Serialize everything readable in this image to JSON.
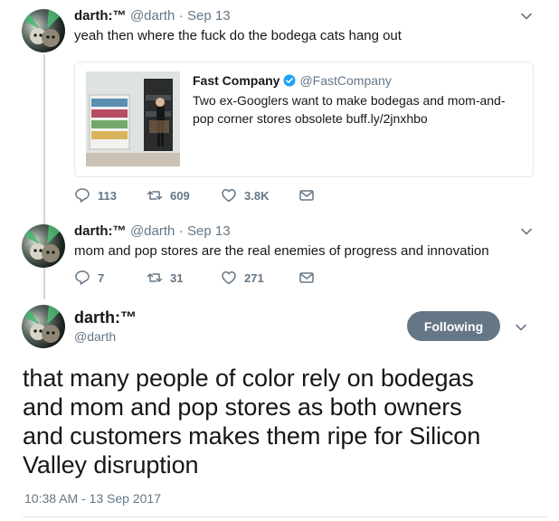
{
  "colors": {
    "text": "#14171a",
    "secondary": "#657786",
    "verified": "#1da1f2",
    "border": "#e1e8ed",
    "following_button": "#657786"
  },
  "tweet1": {
    "name": "darth:™",
    "handle": "@darth",
    "date": "· Sep 13",
    "text": "yeah then where the fuck do the bodega cats hang out",
    "card": {
      "name": "Fast Company",
      "verified_icon": "verified-badge-icon",
      "handle": "@FastCompany",
      "text": "Two ex-Googlers want to make bodegas and mom-and-pop corner stores obsolete buff.ly/2jnxhbo"
    },
    "actions": {
      "replies": "113",
      "retweets": "609",
      "likes": "3.8K"
    }
  },
  "tweet2": {
    "name": "darth:™",
    "handle": "@darth",
    "date": "· Sep 13",
    "text": "mom and pop stores are the real enemies of progress and innovation",
    "actions": {
      "replies": "7",
      "retweets": "31",
      "likes": "271"
    }
  },
  "main": {
    "name": "darth:™",
    "handle": "@darth",
    "follow_label": "Following",
    "text_lines": [
      "that many people of color rely on bodegas",
      "and mom and pop stores as both owners",
      "and customers makes them ripe for Silicon",
      "Valley disruption"
    ],
    "timestamp": "10:38 AM - 13 Sep 2017"
  },
  "icons": {
    "reply": "reply-icon",
    "retweet": "retweet-icon",
    "like": "heart-icon",
    "dm": "envelope-icon",
    "menu": "chevron-down-icon"
  }
}
